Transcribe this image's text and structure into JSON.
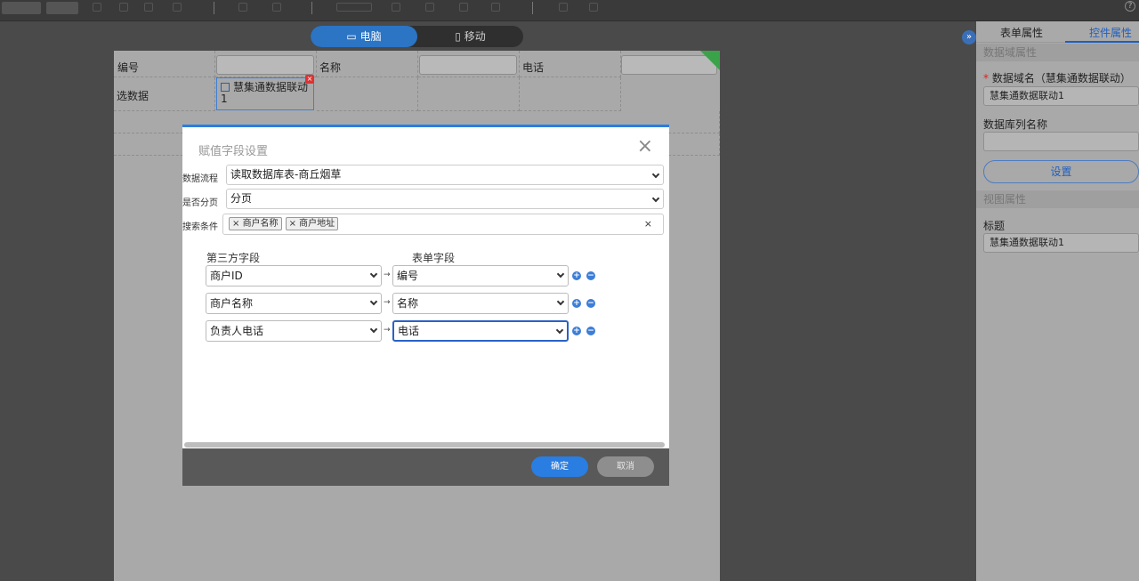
{
  "device_switch": {
    "pc": "电脑",
    "mobile": "移动"
  },
  "form": {
    "row1": {
      "label_no": "编号",
      "label_name": "名称",
      "label_phone": "电话"
    },
    "row2": {
      "label_select": "选数据",
      "control_text": "慧集通数据联动1"
    }
  },
  "panel": {
    "tabs": [
      "表单属性",
      "控件属性"
    ],
    "section_data": "数据域属性",
    "field_name_label": "数据域名（慧集通数据联动）",
    "field_name_value": "慧集通数据联动1",
    "db_column_label": "数据库列名称",
    "set_button": "设置",
    "section_view": "视图属性",
    "title_label": "标题",
    "title_value": "慧集通数据联动1"
  },
  "modal": {
    "title": "赋值字段设置",
    "flow_label": "数据流程",
    "flow_value": "读取数据库表-商丘烟草",
    "paging_label": "是否分页",
    "paging_value": "分页",
    "search_label": "搜索条件",
    "search_tags": [
      "商户名称",
      "商户地址"
    ],
    "col_third": "第三方字段",
    "col_form": "表单字段",
    "mappings": [
      {
        "third": "商户ID",
        "form": "编号"
      },
      {
        "third": "商户名称",
        "form": "名称"
      },
      {
        "third": "负责人电话",
        "form": "电话"
      }
    ],
    "ok": "确定",
    "cancel": "取消"
  }
}
